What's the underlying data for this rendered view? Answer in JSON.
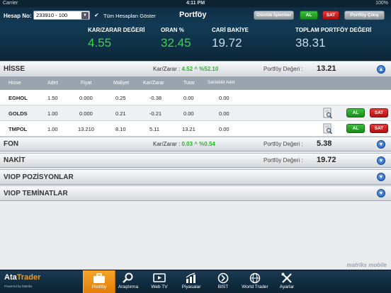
{
  "statusbar": {
    "carrier": "Carrier",
    "time": "4:11 PM",
    "battery": "100%"
  },
  "header": {
    "account_label": "Hesap No:",
    "account_value": "233910 - 100",
    "show_all_label": "Tüm Hesapları Göster",
    "title": "Portföy",
    "daily_trades_btn": "Günlük İşlemler",
    "buy_btn": "AL",
    "sell_btn": "SAT",
    "exit_btn": "Portföy Çıkış"
  },
  "summary": {
    "pl_label": "KAR/ZARAR DEĞERİ",
    "pl_value": "4.55",
    "rate_label": "ORAN %",
    "rate_value": "32.45",
    "balance_label": "CARİ BAKİYE",
    "balance_value": "19.72",
    "total_label": "TOPLAM PORTFÖY DEĞERİ",
    "total_value": "38.31"
  },
  "sections": {
    "hisse": {
      "name": "HİSSE",
      "pl_label": "Kar/Zarar :",
      "pl_value": "4.52 ^ %52.10",
      "pv_label": "Portföy Değeri :",
      "pv_value": "13.21"
    },
    "fon": {
      "name": "FON",
      "pl_label": "Kar/Zarar :",
      "pl_value": "0.03 ^ %0.54",
      "pv_label": "Portföy Değeri :",
      "pv_value": "5.38"
    },
    "nakit": {
      "name": "NAKİT",
      "pv_label": "Portföy Değeri :",
      "pv_value": "19.72"
    },
    "viop_pos": {
      "name": "VIOP POZİSYONLAR"
    },
    "viop_tem": {
      "name": "VIOP TEMİNATLAR"
    }
  },
  "table": {
    "headers": [
      "Hisse",
      "Adet",
      "Fiyat",
      "Maliyet",
      "Kar/Zarar",
      "Tutar",
      "Satılabilir Adet"
    ],
    "rows": [
      {
        "symbol": "EGHOL",
        "qty": "1.50",
        "price": "0.000",
        "cost": "0.25",
        "pl": "-0.38",
        "amount": "0.00",
        "sellable": "0.00"
      },
      {
        "symbol": "GOLDS",
        "qty": "1.00",
        "price": "0.000",
        "cost": "0.21",
        "pl": "-0.21",
        "amount": "0.00",
        "sellable": "0.00"
      },
      {
        "symbol": "TMPOL",
        "qty": "1.00",
        "price": "13.210",
        "cost": "8.10",
        "pl": "5.11",
        "amount": "13.21",
        "sellable": "0.00"
      }
    ],
    "buy_label": "AL",
    "sell_label": "SAT"
  },
  "watermark": "matriks mobile",
  "logo": {
    "part1": "Ata",
    "part2": "Trader",
    "sub": "Powered by Matriks"
  },
  "tabs": [
    {
      "label": "Portföy",
      "icon": "briefcase-icon"
    },
    {
      "label": "Araştırma",
      "icon": "search-icon"
    },
    {
      "label": "Web TV",
      "icon": "tv-icon"
    },
    {
      "label": "Piyasalar",
      "icon": "chart-icon"
    },
    {
      "label": "BIST",
      "icon": "bist-icon"
    },
    {
      "label": "World Trader",
      "icon": "globe-icon"
    },
    {
      "label": "Ayarlar",
      "icon": "tools-icon"
    }
  ],
  "colors": {
    "header_bg": "#133b55",
    "positive": "#3fd34c",
    "accent": "#f39a1d",
    "buy": "#168d16",
    "sell": "#b30f0f"
  }
}
